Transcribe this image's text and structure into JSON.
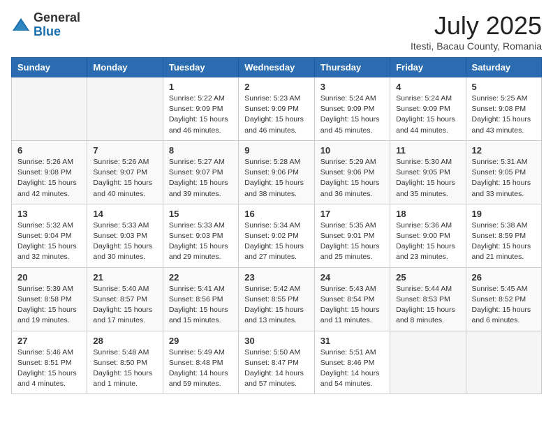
{
  "logo": {
    "general": "General",
    "blue": "Blue"
  },
  "title": "July 2025",
  "location": "Itesti, Bacau County, Romania",
  "days_header": [
    "Sunday",
    "Monday",
    "Tuesday",
    "Wednesday",
    "Thursday",
    "Friday",
    "Saturday"
  ],
  "weeks": [
    [
      {
        "day": "",
        "info": ""
      },
      {
        "day": "",
        "info": ""
      },
      {
        "day": "1",
        "info": "Sunrise: 5:22 AM\nSunset: 9:09 PM\nDaylight: 15 hours and 46 minutes."
      },
      {
        "day": "2",
        "info": "Sunrise: 5:23 AM\nSunset: 9:09 PM\nDaylight: 15 hours and 46 minutes."
      },
      {
        "day": "3",
        "info": "Sunrise: 5:24 AM\nSunset: 9:09 PM\nDaylight: 15 hours and 45 minutes."
      },
      {
        "day": "4",
        "info": "Sunrise: 5:24 AM\nSunset: 9:09 PM\nDaylight: 15 hours and 44 minutes."
      },
      {
        "day": "5",
        "info": "Sunrise: 5:25 AM\nSunset: 9:08 PM\nDaylight: 15 hours and 43 minutes."
      }
    ],
    [
      {
        "day": "6",
        "info": "Sunrise: 5:26 AM\nSunset: 9:08 PM\nDaylight: 15 hours and 42 minutes."
      },
      {
        "day": "7",
        "info": "Sunrise: 5:26 AM\nSunset: 9:07 PM\nDaylight: 15 hours and 40 minutes."
      },
      {
        "day": "8",
        "info": "Sunrise: 5:27 AM\nSunset: 9:07 PM\nDaylight: 15 hours and 39 minutes."
      },
      {
        "day": "9",
        "info": "Sunrise: 5:28 AM\nSunset: 9:06 PM\nDaylight: 15 hours and 38 minutes."
      },
      {
        "day": "10",
        "info": "Sunrise: 5:29 AM\nSunset: 9:06 PM\nDaylight: 15 hours and 36 minutes."
      },
      {
        "day": "11",
        "info": "Sunrise: 5:30 AM\nSunset: 9:05 PM\nDaylight: 15 hours and 35 minutes."
      },
      {
        "day": "12",
        "info": "Sunrise: 5:31 AM\nSunset: 9:05 PM\nDaylight: 15 hours and 33 minutes."
      }
    ],
    [
      {
        "day": "13",
        "info": "Sunrise: 5:32 AM\nSunset: 9:04 PM\nDaylight: 15 hours and 32 minutes."
      },
      {
        "day": "14",
        "info": "Sunrise: 5:33 AM\nSunset: 9:03 PM\nDaylight: 15 hours and 30 minutes."
      },
      {
        "day": "15",
        "info": "Sunrise: 5:33 AM\nSunset: 9:03 PM\nDaylight: 15 hours and 29 minutes."
      },
      {
        "day": "16",
        "info": "Sunrise: 5:34 AM\nSunset: 9:02 PM\nDaylight: 15 hours and 27 minutes."
      },
      {
        "day": "17",
        "info": "Sunrise: 5:35 AM\nSunset: 9:01 PM\nDaylight: 15 hours and 25 minutes."
      },
      {
        "day": "18",
        "info": "Sunrise: 5:36 AM\nSunset: 9:00 PM\nDaylight: 15 hours and 23 minutes."
      },
      {
        "day": "19",
        "info": "Sunrise: 5:38 AM\nSunset: 8:59 PM\nDaylight: 15 hours and 21 minutes."
      }
    ],
    [
      {
        "day": "20",
        "info": "Sunrise: 5:39 AM\nSunset: 8:58 PM\nDaylight: 15 hours and 19 minutes."
      },
      {
        "day": "21",
        "info": "Sunrise: 5:40 AM\nSunset: 8:57 PM\nDaylight: 15 hours and 17 minutes."
      },
      {
        "day": "22",
        "info": "Sunrise: 5:41 AM\nSunset: 8:56 PM\nDaylight: 15 hours and 15 minutes."
      },
      {
        "day": "23",
        "info": "Sunrise: 5:42 AM\nSunset: 8:55 PM\nDaylight: 15 hours and 13 minutes."
      },
      {
        "day": "24",
        "info": "Sunrise: 5:43 AM\nSunset: 8:54 PM\nDaylight: 15 hours and 11 minutes."
      },
      {
        "day": "25",
        "info": "Sunrise: 5:44 AM\nSunset: 8:53 PM\nDaylight: 15 hours and 8 minutes."
      },
      {
        "day": "26",
        "info": "Sunrise: 5:45 AM\nSunset: 8:52 PM\nDaylight: 15 hours and 6 minutes."
      }
    ],
    [
      {
        "day": "27",
        "info": "Sunrise: 5:46 AM\nSunset: 8:51 PM\nDaylight: 15 hours and 4 minutes."
      },
      {
        "day": "28",
        "info": "Sunrise: 5:48 AM\nSunset: 8:50 PM\nDaylight: 15 hours and 1 minute."
      },
      {
        "day": "29",
        "info": "Sunrise: 5:49 AM\nSunset: 8:48 PM\nDaylight: 14 hours and 59 minutes."
      },
      {
        "day": "30",
        "info": "Sunrise: 5:50 AM\nSunset: 8:47 PM\nDaylight: 14 hours and 57 minutes."
      },
      {
        "day": "31",
        "info": "Sunrise: 5:51 AM\nSunset: 8:46 PM\nDaylight: 14 hours and 54 minutes."
      },
      {
        "day": "",
        "info": ""
      },
      {
        "day": "",
        "info": ""
      }
    ]
  ]
}
